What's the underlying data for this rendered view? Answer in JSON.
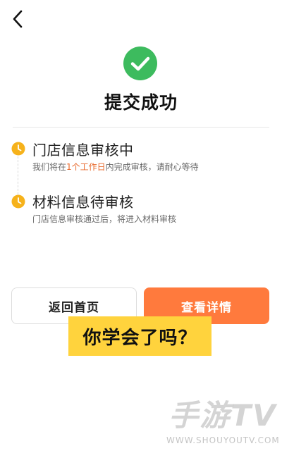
{
  "page": {
    "title": "提交成功"
  },
  "steps": [
    {
      "title": "门店信息审核中",
      "desc_before": "我们将在",
      "desc_highlight": "1个工作日",
      "desc_after": "内完成审核，请耐心等待"
    },
    {
      "title": "材料信息待审核",
      "desc": "门店信息审核通过后，将进入材料审核"
    }
  ],
  "actions": {
    "home_label": "返回首页",
    "detail_label": "查看详情"
  },
  "overlay": {
    "caption": "你学会了吗？"
  },
  "watermark": {
    "logo": "手游TV",
    "url": "WWW.SHOUYOUTV.COM"
  },
  "colors": {
    "success_green": "#3dbb5e",
    "accent_orange": "#ff7a3d",
    "highlight_orange": "#e8682a",
    "step_dot_yellow": "#f6b21b",
    "caption_yellow": "#ffd33d"
  },
  "icons": {
    "back": "chevron-left-icon",
    "success": "check-circle-icon",
    "step": "clock-icon"
  }
}
